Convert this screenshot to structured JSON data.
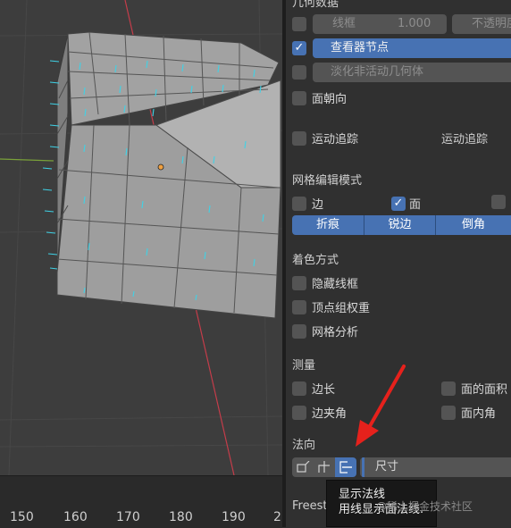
{
  "viewport": {
    "timeline_frames": [
      "150",
      "160",
      "170",
      "180",
      "190",
      "2"
    ]
  },
  "panel": {
    "geometry_header": "几何数据",
    "wireframe": {
      "label": "线框",
      "value": "1.000",
      "checked": false
    },
    "opacity_label": "不透明度",
    "viewer_node": {
      "label": "查看器节点",
      "checked": true
    },
    "fade_inactive": {
      "label": "淡化非活动几何体",
      "checked": false
    },
    "face_orientation": {
      "label": "面朝向",
      "checked": false
    },
    "motion_tracking": {
      "label": "运动追踪",
      "right_label": "运动追踪",
      "checked": false
    },
    "mesh_edit_header": "网格编辑模式",
    "edge": {
      "label": "边",
      "checked": false
    },
    "face": {
      "label": "面",
      "checked": true
    },
    "edge_marks": [
      "折痕",
      "锐边",
      "倒角"
    ],
    "shading_header": "着色方式",
    "hidden_wire": {
      "label": "隐藏线框",
      "checked": false
    },
    "vertex_group_weights": {
      "label": "顶点组权重",
      "checked": false
    },
    "mesh_analysis": {
      "label": "网格分析",
      "checked": false
    },
    "measurement_header": "测量",
    "edge_length": {
      "label": "边长",
      "checked": false
    },
    "face_area": {
      "label": "面的面积",
      "checked": false
    },
    "edge_angle": {
      "label": "边夹角",
      "checked": false
    },
    "face_angle": {
      "label": "面内角",
      "checked": false
    },
    "normals_header": "法向",
    "normals_size_label": "尺寸",
    "freestyle_header": "Freest"
  },
  "tooltip": {
    "title": "显示法线",
    "description": "用线显示面法线."
  },
  "watermark": "@稀土掘金技术社区",
  "colors": {
    "accent": "#4772b3",
    "normals": "#3fd2e6",
    "x_axis": "#c43d4a",
    "y_axis": "#7aa13a",
    "arrow": "#e6211c"
  }
}
